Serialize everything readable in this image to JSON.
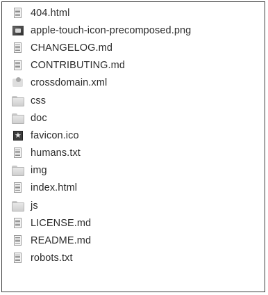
{
  "files": [
    {
      "name": "404.html",
      "icon": "document-icon"
    },
    {
      "name": "apple-touch-icon-precomposed.png",
      "icon": "image-icon"
    },
    {
      "name": "CHANGELOG.md",
      "icon": "document-icon"
    },
    {
      "name": "CONTRIBUTING.md",
      "icon": "document-icon"
    },
    {
      "name": "crossdomain.xml",
      "icon": "xml-file-icon"
    },
    {
      "name": "css",
      "icon": "folder-icon"
    },
    {
      "name": "doc",
      "icon": "folder-icon"
    },
    {
      "name": "favicon.ico",
      "icon": "favicon-icon"
    },
    {
      "name": "humans.txt",
      "icon": "document-icon"
    },
    {
      "name": "img",
      "icon": "folder-icon"
    },
    {
      "name": "index.html",
      "icon": "document-icon"
    },
    {
      "name": "js",
      "icon": "folder-icon"
    },
    {
      "name": "LICENSE.md",
      "icon": "document-icon"
    },
    {
      "name": "README.md",
      "icon": "document-icon"
    },
    {
      "name": "robots.txt",
      "icon": "document-icon"
    }
  ]
}
